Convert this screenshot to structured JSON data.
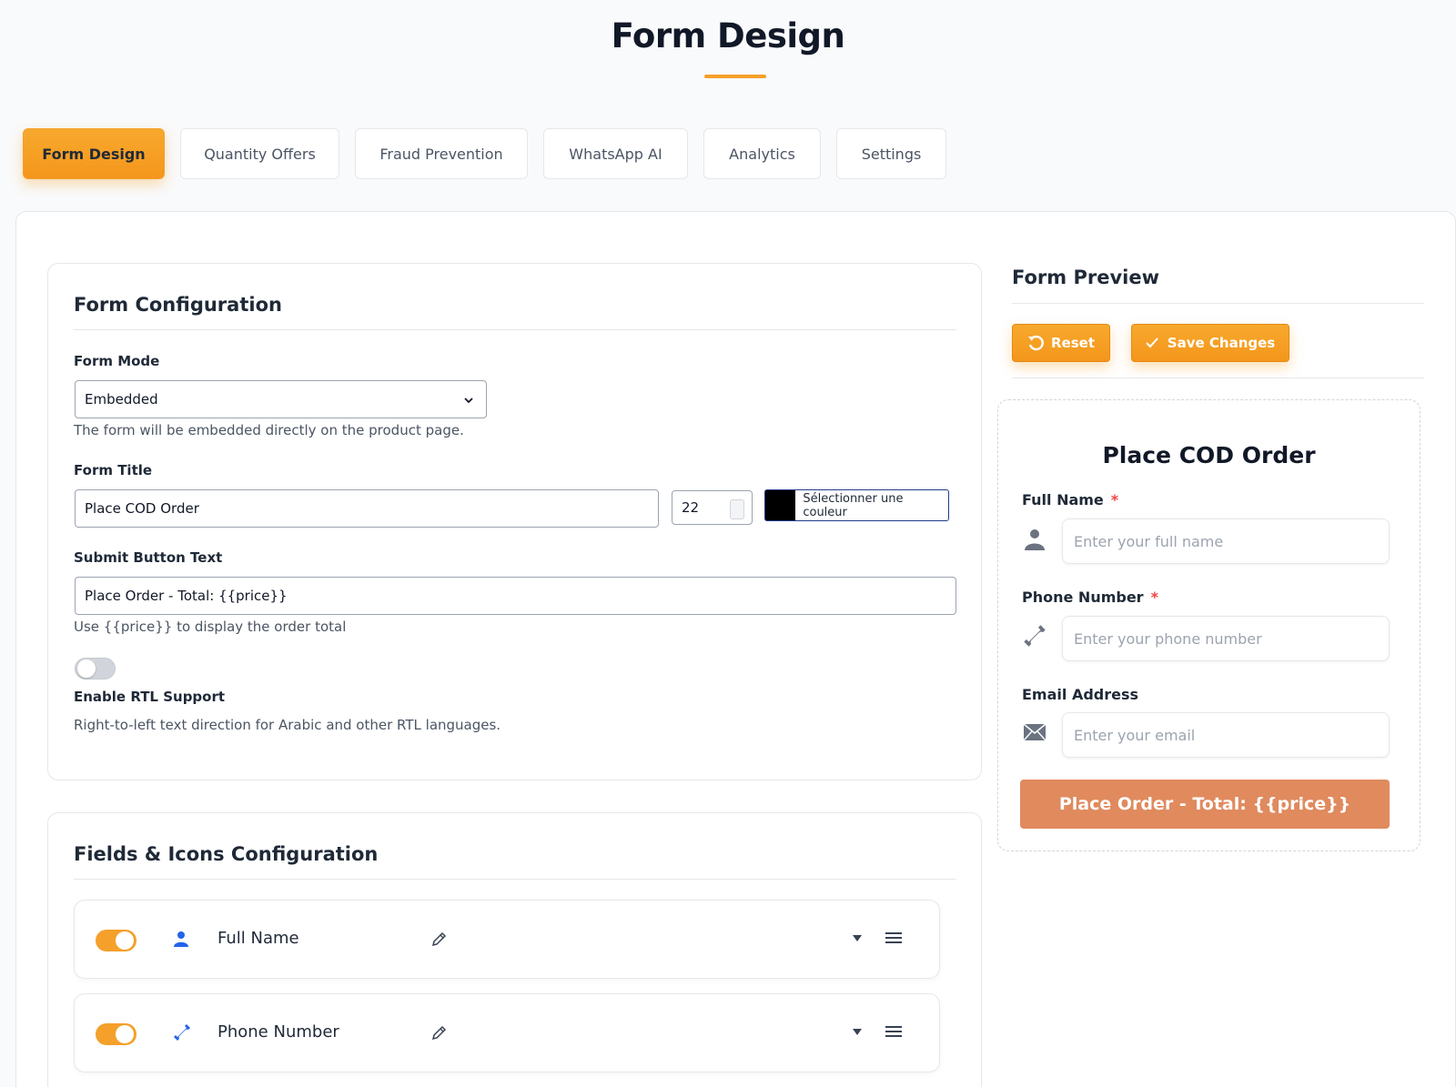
{
  "header": {
    "title": "Form Design"
  },
  "tabs": [
    {
      "label": "Form Design",
      "active": true
    },
    {
      "label": "Quantity Offers",
      "active": false
    },
    {
      "label": "Fraud Prevention",
      "active": false
    },
    {
      "label": "WhatsApp AI",
      "active": false
    },
    {
      "label": "Analytics",
      "active": false
    },
    {
      "label": "Settings",
      "active": false
    }
  ],
  "config": {
    "title": "Form Configuration",
    "form_mode": {
      "label": "Form Mode",
      "value": "Embedded",
      "help": "The form will be embedded directly on the product page."
    },
    "form_title": {
      "label": "Form Title",
      "value": "Place COD Order",
      "font_size": "22",
      "color_button": "Sélectionner une couleur",
      "color": "#000000"
    },
    "submit_text": {
      "label": "Submit Button Text",
      "value": "Place Order - Total: {{price}}",
      "help": "Use {{price}} to display the order total"
    },
    "rtl": {
      "label": "Enable RTL Support",
      "help": "Right-to-left text direction for Arabic and other RTL languages.",
      "enabled": false
    }
  },
  "fields_config": {
    "title": "Fields & Icons Configuration",
    "fields": [
      {
        "label": "Full Name",
        "enabled": true,
        "icon": "user-icon"
      },
      {
        "label": "Phone Number",
        "enabled": true,
        "icon": "phone-icon"
      }
    ]
  },
  "preview": {
    "title": "Form Preview",
    "reset_label": "Reset",
    "save_label": "Save Changes",
    "form_title": "Place COD Order",
    "full_name": {
      "label": "Full Name",
      "required": "*",
      "placeholder": "Enter your full name"
    },
    "phone": {
      "label": "Phone Number",
      "required": "*",
      "placeholder": "Enter your phone number"
    },
    "email": {
      "label": "Email Address",
      "placeholder": "Enter your email"
    },
    "submit": "Place Order - Total: {{price}}"
  },
  "colors": {
    "accent": "#f4a02b",
    "submit_preview": "#e08a5e",
    "field_icon": "#2563eb"
  }
}
